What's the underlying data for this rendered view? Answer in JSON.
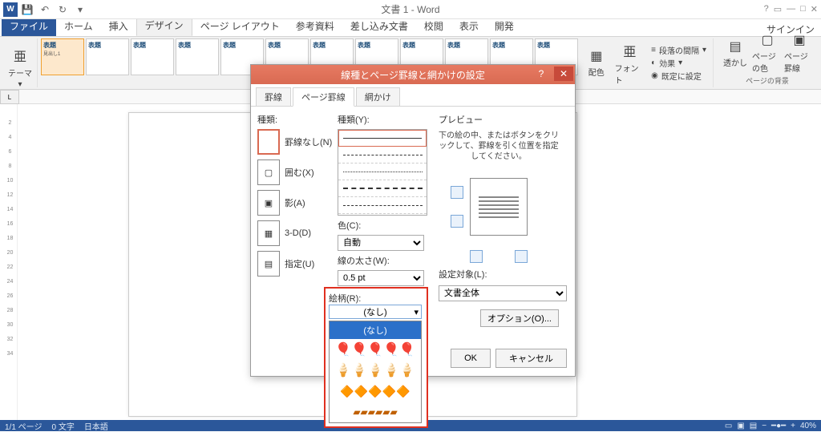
{
  "titlebar": {
    "title": "文書 1 - Word"
  },
  "tabs": {
    "file": "ファイル",
    "items": [
      "ホーム",
      "挿入",
      "デザイン",
      "ページ レイアウト",
      "参考資料",
      "差し込み文書",
      "校閲",
      "表示",
      "開発"
    ],
    "active_index": 2,
    "signin": "サインイン"
  },
  "ribbon": {
    "themes_label": "テーマ",
    "gallery_title": "表題",
    "formatting_group": {
      "paragraph_spacing": "段落の間隔",
      "effects": "効果",
      "set_default": "既定に設定"
    },
    "colors_label": "配色",
    "fonts_label": "フォント",
    "watermark": "透かし",
    "page_color": "ページの色",
    "page_borders": "ページ罫線",
    "bg_group": "ページの背景"
  },
  "dialog": {
    "title": "線種とページ罫線と網かけの設定",
    "tabs": [
      "罫線",
      "ページ罫線",
      "網かけ"
    ],
    "active_tab": 1,
    "setting_label": "種類:",
    "settings": [
      {
        "label": "罫線なし(N)"
      },
      {
        "label": "囲む(X)"
      },
      {
        "label": "影(A)"
      },
      {
        "label": "3-D(D)"
      },
      {
        "label": "指定(U)"
      }
    ],
    "style_label": "種類(Y):",
    "color_label": "色(C):",
    "color_value": "自動",
    "width_label": "線の太さ(W):",
    "width_value": "0.5 pt",
    "art_label": "絵柄(R):",
    "art_value": "(なし)",
    "art_options": [
      "(なし)"
    ],
    "preview_label": "プレビュー",
    "preview_hint": "下の絵の中、またはボタンをクリックして、罫線を引く位置を指定してください。",
    "apply_label": "設定対象(L):",
    "apply_value": "文書全体",
    "options_btn": "オプション(O)...",
    "ok": "OK",
    "cancel": "キャンセル"
  },
  "status": {
    "page": "1/1 ページ",
    "words": "0 文字",
    "lang": "日本語",
    "zoom": "40%"
  }
}
